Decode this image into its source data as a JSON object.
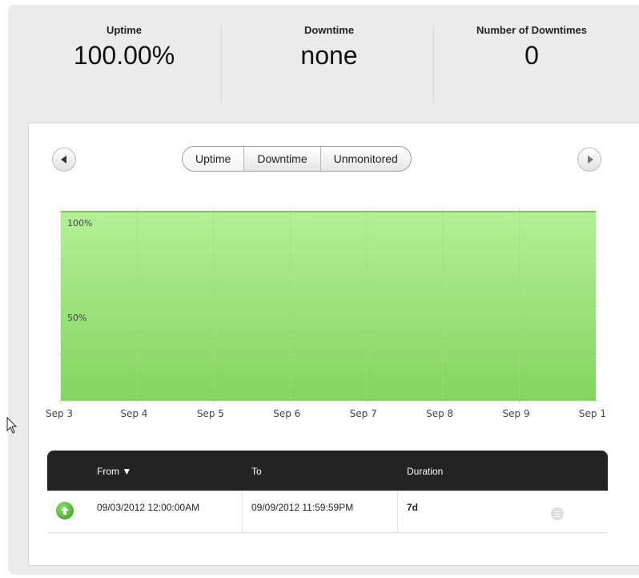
{
  "summary": {
    "uptime_label": "Uptime",
    "uptime_value": "100.00%",
    "downtime_label": "Downtime",
    "downtime_value": "none",
    "count_label": "Number of Downtimes",
    "count_value": "0"
  },
  "tabs": [
    "Uptime",
    "Downtime",
    "Unmonitored"
  ],
  "active_tab": "Uptime",
  "chart_data": {
    "type": "area",
    "x": [
      "Sep 3",
      "Sep 4",
      "Sep 5",
      "Sep 6",
      "Sep 7",
      "Sep 8",
      "Sep 9",
      "Sep 1"
    ],
    "series": [
      {
        "values": [
          100,
          100,
          100,
          100,
          100,
          100,
          100,
          100
        ]
      }
    ],
    "ytick_labels": [
      "100%",
      "50%"
    ],
    "ylim": [
      0,
      100
    ],
    "grid": true,
    "colors": {
      "fill_top": "#b3f096",
      "fill_bottom": "#84d45f",
      "line": "#79c853"
    }
  },
  "table": {
    "columns": [
      "From ▼",
      "To",
      "Duration"
    ],
    "rows": [
      {
        "status": "up",
        "from": "09/03/2012 12:00:00AM",
        "to": "09/09/2012 11:59:59PM",
        "duration": "7d"
      }
    ]
  }
}
